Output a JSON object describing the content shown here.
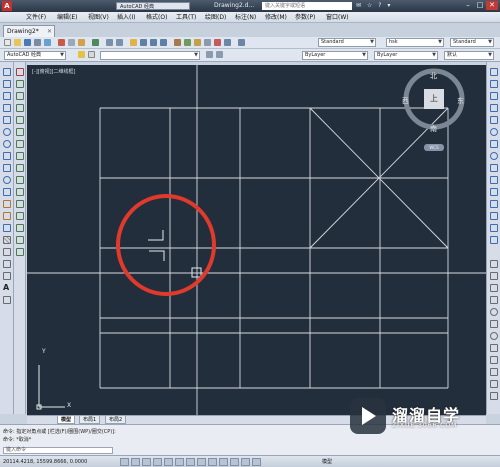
{
  "titlebar": {
    "workspace": "AutoCAD 经典",
    "document": "Drawing2.d...",
    "search_placeholder": "键入关键字或短语",
    "right_icons": "✉ ☆ ? ▾"
  },
  "menubar": {
    "items": [
      "文件(F)",
      "编辑(E)",
      "视图(V)",
      "插入(I)",
      "格式(O)",
      "工具(T)",
      "绘图(D)",
      "标注(N)",
      "修改(M)",
      "参数(P)",
      "窗口(W)"
    ]
  },
  "tabs": {
    "file_tab": "Drawing2*",
    "close": "✕"
  },
  "toolbar": {
    "workspace_combo": "AutoCAD 经典",
    "text_style": "Standard",
    "dim_style": "hsk",
    "table_style": "Standard",
    "layer_color": "ByLayer",
    "linetype": "ByLayer",
    "lineweight": "默认"
  },
  "canvas": {
    "view_label": "[-][俯视][二维线框]",
    "viewcube": {
      "north": "北",
      "south": "南",
      "west": "西",
      "east": "东",
      "top": "上"
    },
    "wcs": "WCS",
    "ucs_y": "Y",
    "ucs_x": "X"
  },
  "layout_tabs": [
    "模型",
    "布局1",
    "布局2"
  ],
  "command": {
    "line1": "命令: 指定对角点或 [栏选(F)/圈围(WP)/圈交(CP)]:",
    "line2": "命令: *取消*",
    "input_placeholder": "键入命令"
  },
  "statusbar": {
    "coords": "20114.4218, 15599.8666, 0.0000",
    "model": "模型"
  },
  "watermark": {
    "brand": "溜溜自学",
    "url": "ZIXUE.3066.COM"
  },
  "colors": {
    "canvas_bg": "#232e3c",
    "grid_lines": "#d7dbe1",
    "highlight_circle": "#e03a2c"
  }
}
